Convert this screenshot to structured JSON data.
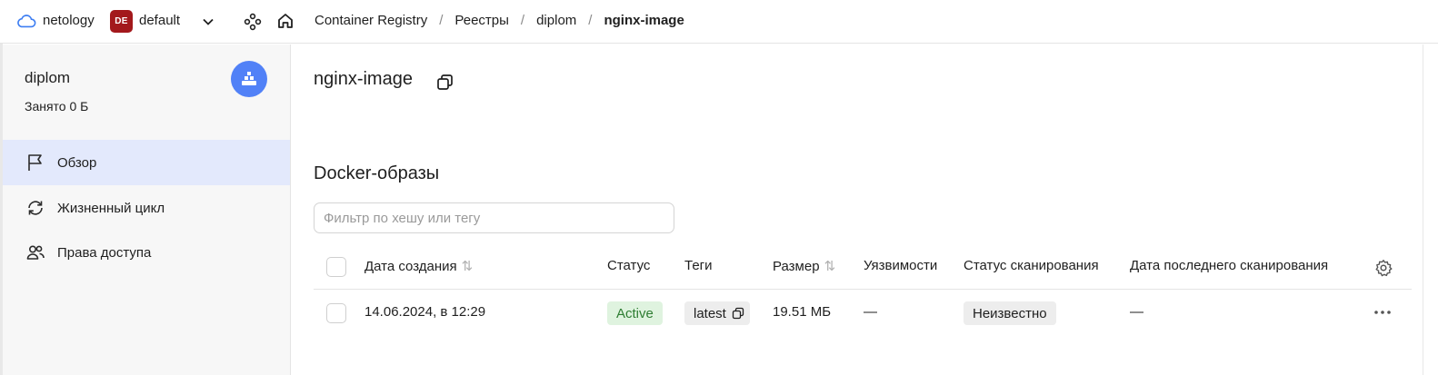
{
  "header": {
    "org": "netology",
    "folder_badge": "DE",
    "folder": "default",
    "breadcrumbs": [
      "Container Registry",
      "Реестры",
      "diplom"
    ],
    "current": "nginx-image",
    "separator": "/"
  },
  "sidebar": {
    "registry_name": "diplom",
    "used": "Занято 0 Б",
    "items": [
      {
        "label": "Обзор",
        "icon": "flag-icon",
        "active": true
      },
      {
        "label": "Жизненный цикл",
        "icon": "refresh-icon",
        "active": false
      },
      {
        "label": "Права доступа",
        "icon": "users-icon",
        "active": false
      }
    ]
  },
  "main": {
    "title": "nginx-image",
    "section": "Docker-образы",
    "filter_placeholder": "Фильтр по хешу или тегу",
    "columns": [
      "Дата создания",
      "Статус",
      "Теги",
      "Размер",
      "Уязвимости",
      "Статус сканирования",
      "Дата последнего сканирования"
    ],
    "rows": [
      {
        "created": "14.06.2024, в 12:29",
        "status": "Active",
        "tag": "latest",
        "size": "19.51 МБ",
        "vulnerabilities": "—",
        "scan_status": "Неизвестно",
        "last_scan": "—"
      }
    ]
  },
  "colors": {
    "accent": "#5181f7",
    "active_nav": "#e3e9fc",
    "badge": "#a3191c",
    "status_active_bg": "#dff3df",
    "status_active_fg": "#2e7d32"
  }
}
